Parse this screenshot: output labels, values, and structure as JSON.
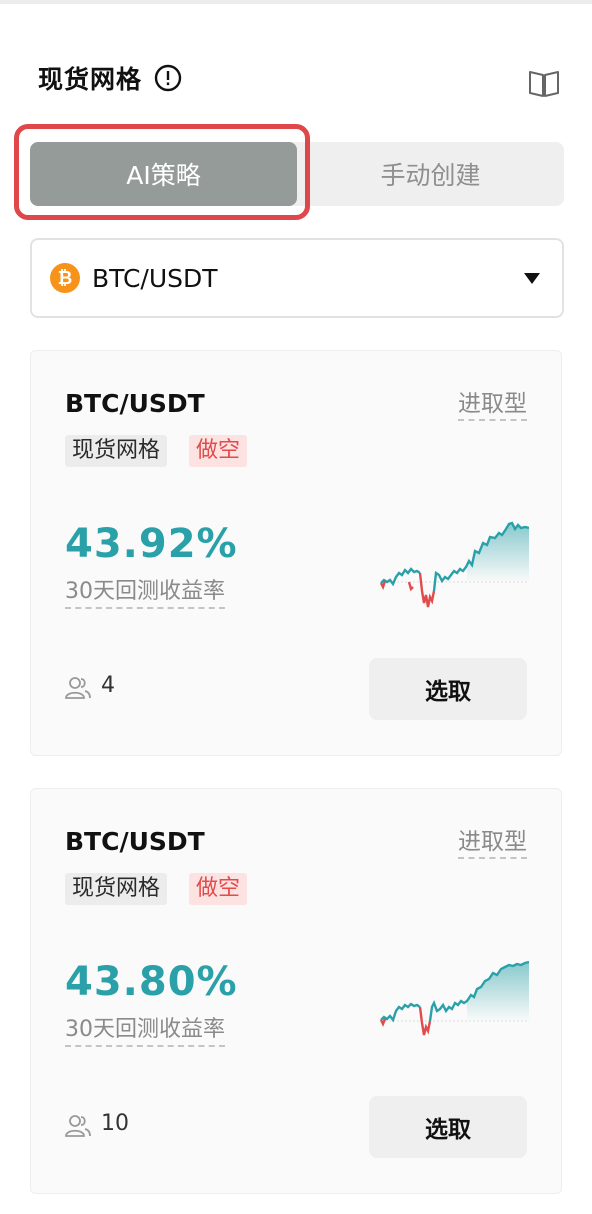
{
  "header": {
    "title": "现货网格"
  },
  "tabs": [
    {
      "label": "AI策略",
      "active": true
    },
    {
      "label": "手动创建",
      "active": false
    }
  ],
  "pair_selector": {
    "coin_symbol": "₿",
    "value": "BTC/USDT"
  },
  "colors": {
    "accent_teal": "#2aa1a8",
    "loss_red": "#e14b4b",
    "highlight_red": "#e0474a",
    "active_tab": "#959b98"
  },
  "strategies": [
    {
      "pair": "BTC/USDT",
      "risk_level": "进取型",
      "tags": [
        "现货网格",
        "做空"
      ],
      "roi": "43.92%",
      "roi_label": "30天回测收益率",
      "users": "4",
      "button": "选取"
    },
    {
      "pair": "BTC/USDT",
      "risk_level": "进取型",
      "tags": [
        "现货网格",
        "做空"
      ],
      "roi": "43.80%",
      "roi_label": "30天回测收益率",
      "users": "10",
      "button": "选取"
    }
  ]
}
